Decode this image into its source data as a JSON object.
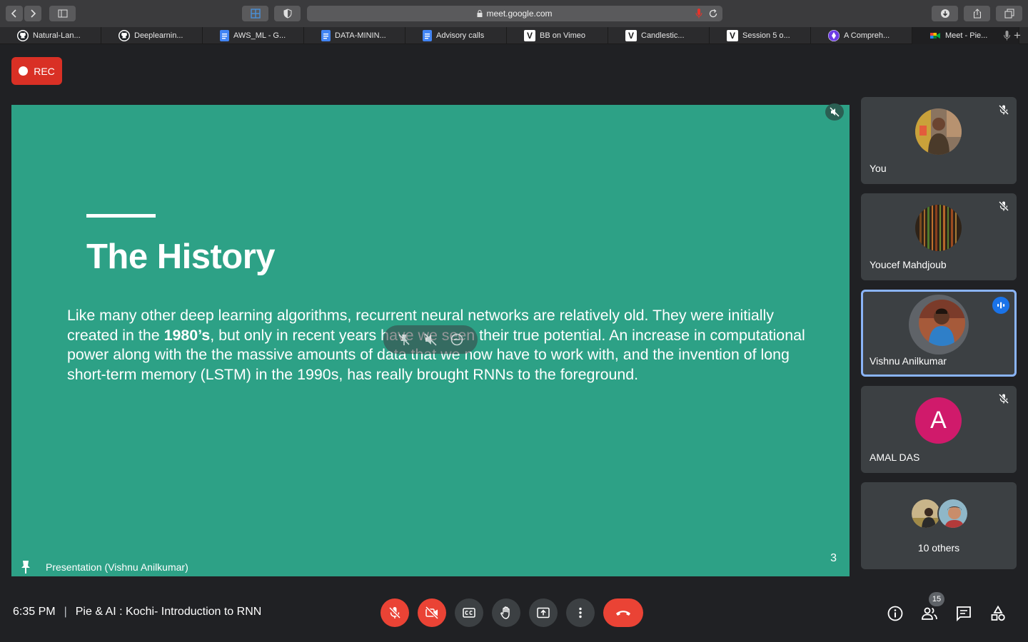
{
  "browser": {
    "url": "meet.google.com",
    "tabs": [
      {
        "label": "Natural-Lan...",
        "icon": "github-icon"
      },
      {
        "label": "Deeplearnin...",
        "icon": "github-icon"
      },
      {
        "label": "AWS_ML - G...",
        "icon": "docs-icon"
      },
      {
        "label": "DATA-MININ...",
        "icon": "docs-icon"
      },
      {
        "label": "Advisory calls",
        "icon": "docs-icon"
      },
      {
        "label": "BB on Vimeo",
        "icon": "vimeo-icon"
      },
      {
        "label": "Candlestic...",
        "icon": "vimeo-icon"
      },
      {
        "label": "Session 5 o...",
        "icon": "vimeo-icon"
      },
      {
        "label": "A Compreh...",
        "icon": "compass-icon"
      },
      {
        "label": "Meet - Pie...",
        "icon": "meet-icon",
        "active": true
      }
    ]
  },
  "recording": {
    "label": "REC"
  },
  "presentation": {
    "slide_title": "The History",
    "body_part1": "Like many other deep learning algorithms, recurrent neural networks are relatively old. They were initially created in the ",
    "body_bold": "1980’s",
    "body_part2": ", but only in recent years have we seen their true potential. An increase in computational power along with the the massive amounts of data that we now have to work with, and the invention of long short-term memory (LSTM) in the 1990s, has really brought RNNs to the foreground.",
    "slide_number": "3",
    "label": "Presentation (Vishnu Anilkumar)"
  },
  "participants": [
    {
      "name": "You",
      "muted": true
    },
    {
      "name": "Youcef Mahdjoub",
      "muted": true
    },
    {
      "name": "Vishnu Anilkumar",
      "speaking": true
    },
    {
      "name": "AMAL DAS",
      "initial": "A",
      "muted": true
    },
    {
      "name": "10 others"
    }
  ],
  "meeting": {
    "time": "6:35 PM",
    "separator": "|",
    "title": "Pie & AI : Kochi- Introduction to RNN",
    "participant_count": "15"
  },
  "colors": {
    "slide_bg": "#2da186",
    "danger": "#ea4335",
    "speaking_border": "#8ab4f8",
    "app_bg": "#202124",
    "tile_bg": "#3c4043"
  }
}
